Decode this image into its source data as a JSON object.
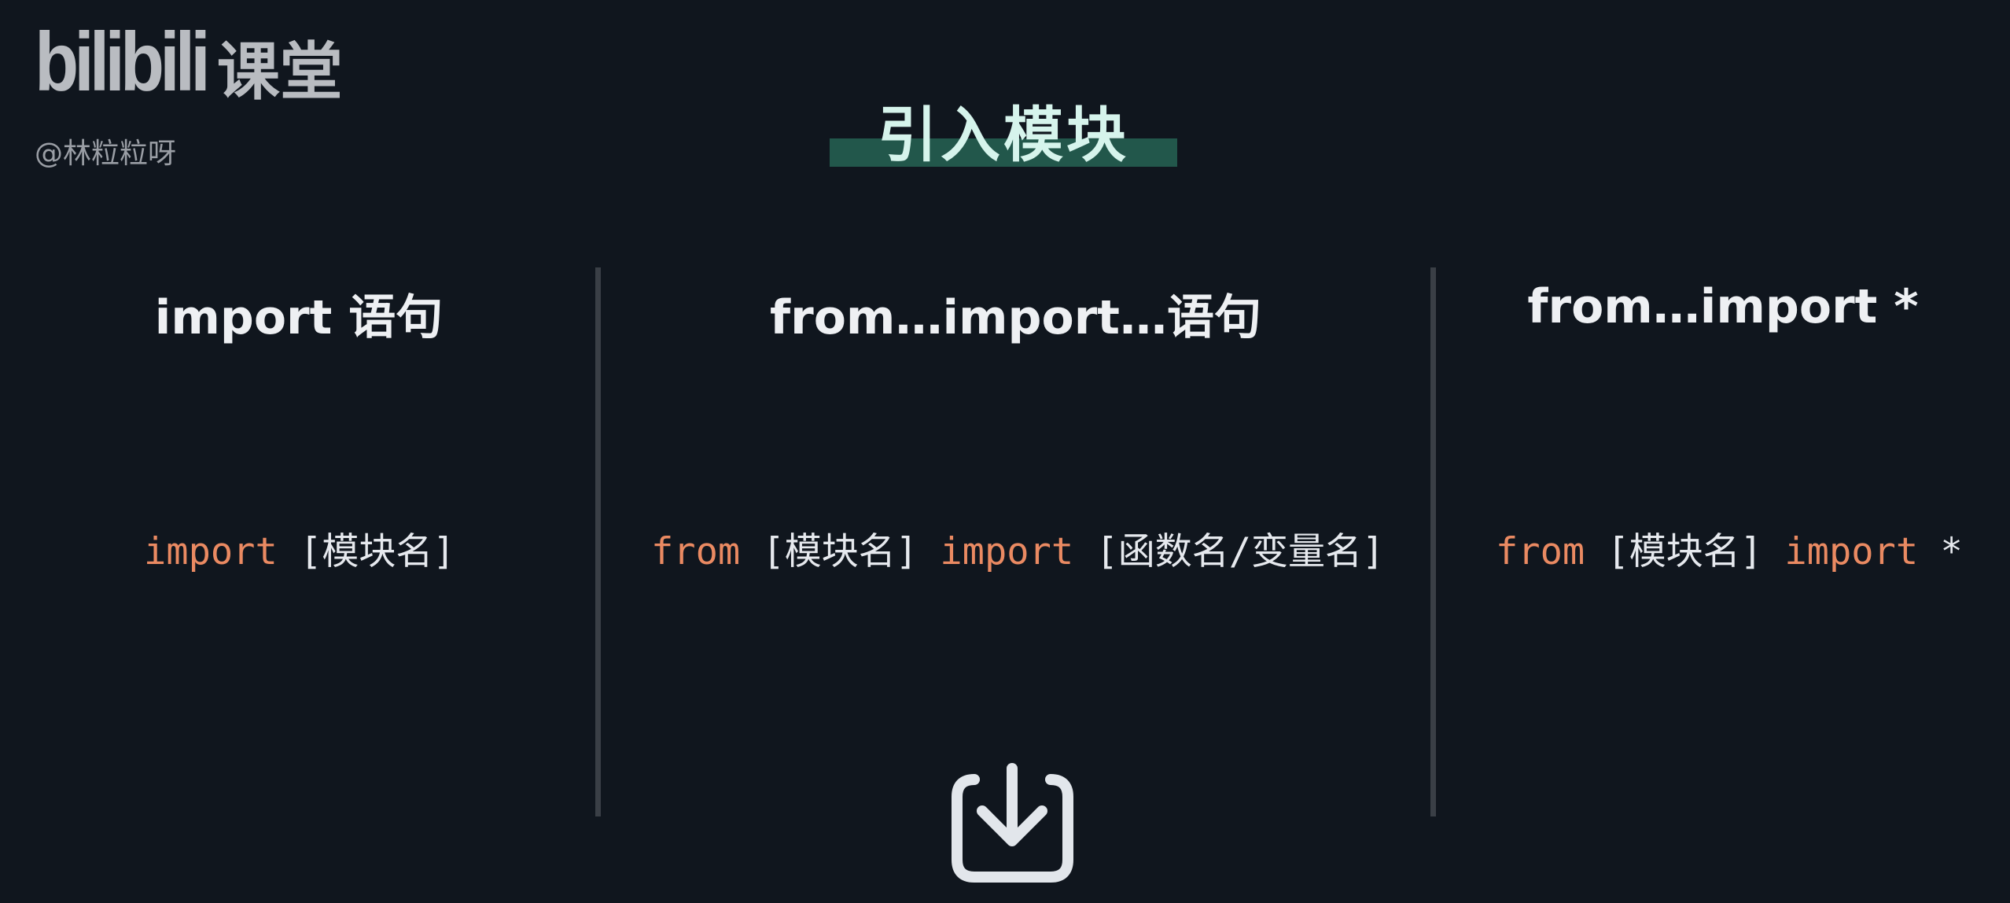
{
  "branding": {
    "logo": "bilibili",
    "logo_suffix": "课堂",
    "author": "@林粒粒呀"
  },
  "title": "引入模块",
  "columns": [
    {
      "heading": "import 语句",
      "code": [
        {
          "text": "import",
          "kw": true
        },
        {
          "text": " [模块名]",
          "kw": false
        }
      ]
    },
    {
      "heading": "from…import…语句",
      "code": [
        {
          "text": "from",
          "kw": true
        },
        {
          "text": " [模块名] ",
          "kw": false
        },
        {
          "text": "import",
          "kw": true
        },
        {
          "text": " [函数名/变量名]",
          "kw": false
        }
      ]
    },
    {
      "heading": "from…import *",
      "code": [
        {
          "text": "from",
          "kw": true
        },
        {
          "text": " [模块名] ",
          "kw": false
        },
        {
          "text": "import",
          "kw": true
        },
        {
          "text": " *",
          "kw": false
        }
      ]
    }
  ],
  "icon": "download-tray-icon",
  "colors": {
    "background": "#10161e",
    "keyword": "#ea8a62",
    "title_highlight": "#22574b"
  }
}
